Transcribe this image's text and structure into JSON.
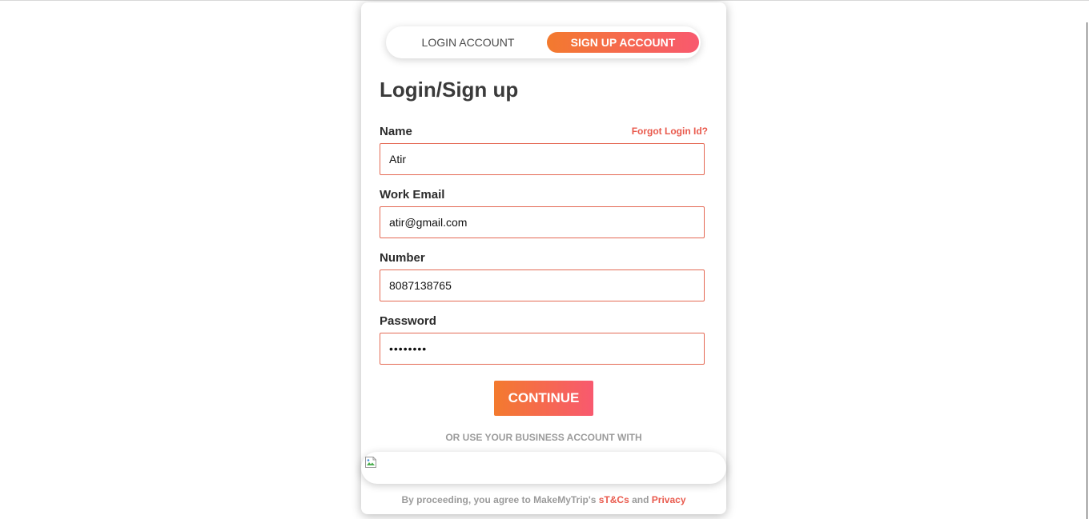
{
  "tabs": {
    "login_label": "LOGIN ACCOUNT",
    "signup_label": "SIGN UP ACCOUNT"
  },
  "form": {
    "title": "Login/Sign up",
    "forgot_label": "Forgot Login Id?",
    "fields": {
      "name": {
        "label": "Name",
        "value": "Atir"
      },
      "email": {
        "label": "Work Email",
        "value": "atir@gmail.com"
      },
      "number": {
        "label": "Number",
        "value": "8087138765"
      },
      "password": {
        "label": "Password",
        "value": "••••••••"
      }
    },
    "continue_label": "CONTINUE"
  },
  "business": {
    "prompt": "OR USE YOUR BUSINESS ACCOUNT WITH",
    "icon": "broken-image-icon"
  },
  "footer": {
    "prefix": "By proceeding, you agree to MakeMyTrip's",
    "terms_link": "sT&Cs",
    "and": "and",
    "privacy_link": "Privacy"
  },
  "colors": {
    "accent_start": "#f37a2e",
    "accent_end": "#f8596f",
    "link": "#e95a4d",
    "input_border": "#e46a55"
  }
}
